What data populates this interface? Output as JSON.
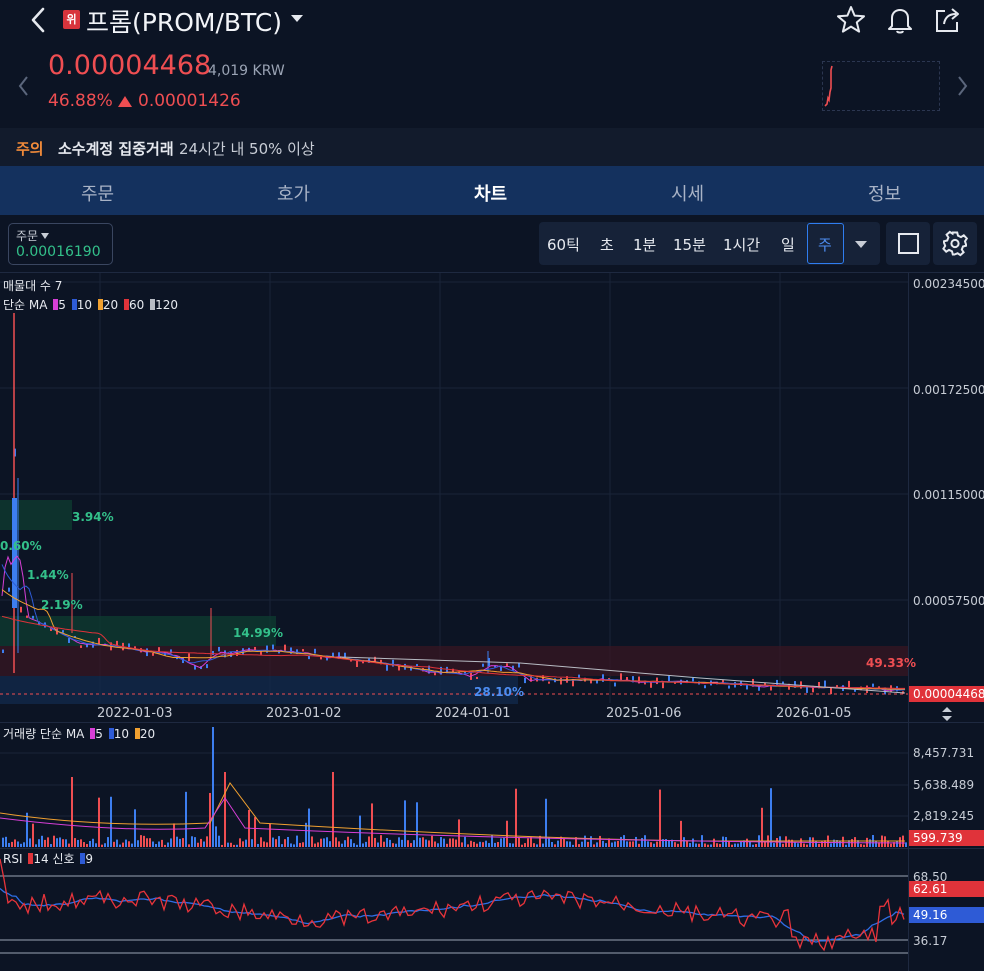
{
  "header": {
    "badge": "위",
    "title": "프롬(PROM/BTC)"
  },
  "price": {
    "value": "0.00004468",
    "krw": "4,019 KRW",
    "change_pct": "46.88%",
    "change_abs": "0.00001426"
  },
  "notice": {
    "label": "주의",
    "text": "소수계정 집중거래",
    "sub": "24시간 내 50% 이상"
  },
  "tabs": [
    "주문",
    "호가",
    "차트",
    "시세",
    "정보"
  ],
  "active_tab": "차트",
  "toolbar": {
    "order_label": "주문",
    "order_value": "0.00016190",
    "timeframes": [
      "60틱",
      "초",
      "1분",
      "15분",
      "1시간",
      "일"
    ],
    "selected_timeframe": "주"
  },
  "colors": {
    "up": "#ef4e52",
    "down": "#3d7ef0",
    "ma5": "#d63fd6",
    "ma10": "#2e5bd6",
    "ma20": "#f0a030",
    "ma60": "#e0333a",
    "ma120": "#b8bcc4"
  },
  "chart": {
    "vp_label": "매물대 수 7",
    "ma_label": "단순 MA",
    "ma_periods": [
      "5",
      "10",
      "20",
      "60",
      "120"
    ],
    "y_ticks": [
      "0.00234500",
      "0.00172500",
      "0.00115000",
      "0.00057500"
    ],
    "current_price_tag": "0.00004468",
    "x_ticks": [
      "2022-01-03",
      "2023-01-02",
      "2024-01-01",
      "2025-01-06",
      "2026-01-05"
    ],
    "zones": [
      "3.94%",
      "0.60%",
      "1.44%",
      "2.19%",
      "14.99%",
      "49.33%",
      "28.10%"
    ]
  },
  "volume": {
    "label": "거래량 단순 MA",
    "ma_periods": [
      "5",
      "10",
      "20"
    ],
    "y_ticks": [
      "8,457.731",
      "5,638.489",
      "2,819.245"
    ],
    "current_tag": "599.739"
  },
  "rsi": {
    "label": "RSI",
    "period": "14",
    "signal_label": "신호",
    "signal_period": "9",
    "y_ticks": [
      "68.50",
      "36.17"
    ],
    "rsi_tag": "62.61",
    "signal_tag": "49.16"
  }
}
